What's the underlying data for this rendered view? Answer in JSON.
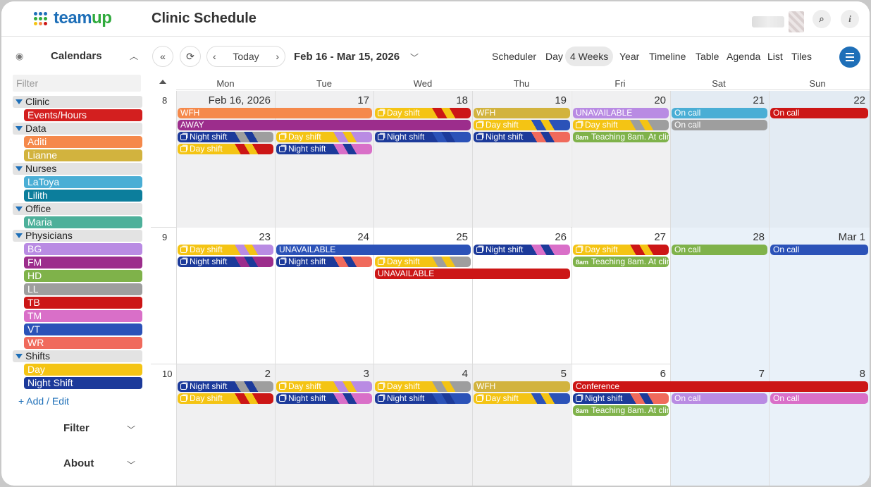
{
  "app": {
    "logo_text_a": "team",
    "logo_text_b": "up",
    "page_title": "Clinic Schedule"
  },
  "topbar": {
    "search_icon": "search-icon",
    "info_icon": "info-icon",
    "search_glyph": "⌕",
    "info_glyph": "i"
  },
  "sidebar": {
    "calendars_title": "Calendars",
    "filter_placeholder": "Filter",
    "groups": [
      {
        "name": "Clinic",
        "items": [
          {
            "label": "Events/Hours",
            "color": "#d31f1f"
          }
        ]
      },
      {
        "name": "Data",
        "items": [
          {
            "label": "Aditi",
            "color": "#f5894b"
          },
          {
            "label": "Lianne",
            "color": "#d2b33e"
          }
        ]
      },
      {
        "name": "Nurses",
        "items": [
          {
            "label": "LaToya",
            "color": "#4aaed5"
          },
          {
            "label": "Lilith",
            "color": "#0c7e9c"
          }
        ]
      },
      {
        "name": "Office",
        "items": [
          {
            "label": "Maria",
            "color": "#4db09a"
          }
        ]
      },
      {
        "name": "Physicians",
        "items": [
          {
            "label": "BG",
            "color": "#b98be3"
          },
          {
            "label": "FM",
            "color": "#9c2d8c"
          },
          {
            "label": "HD",
            "color": "#7fb24a"
          },
          {
            "label": "LL",
            "color": "#9e9e9e"
          },
          {
            "label": "TB",
            "color": "#cc1616"
          },
          {
            "label": "TM",
            "color": "#d96fc8"
          },
          {
            "label": "VT",
            "color": "#2b52b8"
          },
          {
            "label": "WR",
            "color": "#f06a5c"
          }
        ]
      },
      {
        "name": "Shifts",
        "items": [
          {
            "label": "Day",
            "color": "#f4c414"
          },
          {
            "label": "Night Shift",
            "color": "#1c3a9a"
          }
        ]
      }
    ],
    "add_edit": "+ Add / Edit",
    "filter_section": "Filter",
    "about_section": "About"
  },
  "toolbar": {
    "today": "Today",
    "date_range": "Feb 16 - Mar 15, 2026",
    "views": [
      "Scheduler",
      "Day",
      "4 Weeks",
      "Year",
      "Timeline",
      "Table",
      "Agenda",
      "List",
      "Tiles"
    ],
    "active_view": "4 Weeks"
  },
  "calendar": {
    "day_headers": [
      "Mon",
      "Tue",
      "Wed",
      "Thu",
      "Fri",
      "Sat",
      "Sun"
    ],
    "weeks": [
      {
        "num": "8",
        "days": [
          "Feb 16, 2026",
          "17",
          "18",
          "19",
          "20",
          "21",
          "22"
        ],
        "events": [
          {
            "col": 0,
            "span": 2,
            "lane": 0,
            "text": "WFH",
            "color": "#f5894b"
          },
          {
            "col": 2,
            "span": 1,
            "lane": 0,
            "text": "Day shift",
            "color": "#f4c414",
            "stripe": "#cc1616",
            "icon": true
          },
          {
            "col": 3,
            "span": 1,
            "lane": 0,
            "text": "WFH",
            "color": "#d2b33e"
          },
          {
            "col": 4,
            "span": 1,
            "lane": 0,
            "text": "UNAVAILABLE",
            "color": "#b98be3"
          },
          {
            "col": 5,
            "span": 1,
            "lane": 0,
            "text": "On call",
            "color": "#4aaed5"
          },
          {
            "col": 6,
            "span": 1,
            "lane": 0,
            "text": "On call",
            "color": "#cc1616"
          },
          {
            "col": 0,
            "span": 3,
            "lane": 1,
            "text": "AWAY",
            "color": "#9c2d8c"
          },
          {
            "col": 3,
            "span": 1,
            "lane": 1,
            "text": "Day shift",
            "color": "#f4c414",
            "stripe": "#2b52b8",
            "icon": true
          },
          {
            "col": 4,
            "span": 1,
            "lane": 1,
            "text": "Day shift",
            "color": "#f4c414",
            "stripe": "#9e9e9e",
            "icon": true
          },
          {
            "col": 5,
            "span": 1,
            "lane": 1,
            "text": "On call",
            "color": "#9e9e9e"
          },
          {
            "col": 0,
            "span": 1,
            "lane": 2,
            "text": "Night shift",
            "color": "#1c3a9a",
            "stripe": "#9e9e9e",
            "icon": true
          },
          {
            "col": 1,
            "span": 1,
            "lane": 2,
            "text": "Day shift",
            "color": "#f4c414",
            "stripe": "#b98be3",
            "icon": true
          },
          {
            "col": 2,
            "span": 1,
            "lane": 2,
            "text": "Night shift",
            "color": "#1c3a9a",
            "stripe": "#2b52b8",
            "icon": true
          },
          {
            "col": 3,
            "span": 1,
            "lane": 2,
            "text": "Night shift",
            "color": "#1c3a9a",
            "stripe": "#f06a5c",
            "icon": true
          },
          {
            "col": 4,
            "span": 1,
            "lane": 2,
            "text": "Teaching 8am. At clinic",
            "time": "8am",
            "color": "#7fb24a"
          },
          {
            "col": 0,
            "span": 1,
            "lane": 3,
            "text": "Day shift",
            "color": "#f4c414",
            "stripe": "#cc1616",
            "icon": true
          },
          {
            "col": 1,
            "span": 1,
            "lane": 3,
            "text": "Night shift",
            "color": "#1c3a9a",
            "stripe": "#d96fc8",
            "icon": true
          }
        ]
      },
      {
        "num": "9",
        "days": [
          "23",
          "24",
          "25",
          "26",
          "27",
          "28",
          "Mar 1"
        ],
        "events": [
          {
            "col": 0,
            "span": 1,
            "lane": 0,
            "text": "Day shift",
            "color": "#f4c414",
            "stripe": "#b98be3",
            "icon": true
          },
          {
            "col": 1,
            "span": 2,
            "lane": 0,
            "text": "UNAVAILABLE",
            "color": "#2b52b8"
          },
          {
            "col": 3,
            "span": 1,
            "lane": 0,
            "text": "Night shift",
            "color": "#1c3a9a",
            "stripe": "#d96fc8",
            "icon": true
          },
          {
            "col": 4,
            "span": 1,
            "lane": 0,
            "text": "Day shift",
            "color": "#f4c414",
            "stripe": "#cc1616",
            "icon": true
          },
          {
            "col": 5,
            "span": 1,
            "lane": 0,
            "text": "On call",
            "color": "#7fb24a"
          },
          {
            "col": 6,
            "span": 1,
            "lane": 0,
            "text": "On call",
            "color": "#2b52b8"
          },
          {
            "col": 0,
            "span": 1,
            "lane": 1,
            "text": "Night shift",
            "color": "#1c3a9a",
            "stripe": "#9c2d8c",
            "icon": true
          },
          {
            "col": 1,
            "span": 1,
            "lane": 1,
            "text": "Night shift",
            "color": "#1c3a9a",
            "stripe": "#f06a5c",
            "icon": true
          },
          {
            "col": 2,
            "span": 1,
            "lane": 1,
            "text": "Day shift",
            "color": "#f4c414",
            "stripe": "#9e9e9e",
            "icon": true
          },
          {
            "col": 4,
            "span": 1,
            "lane": 1,
            "text": "Teaching 8am. At clinic",
            "time": "8am",
            "color": "#7fb24a"
          },
          {
            "col": 2,
            "span": 2,
            "lane": 2,
            "text": "UNAVAILABLE",
            "color": "#cc1616"
          }
        ]
      },
      {
        "num": "10",
        "days": [
          "2",
          "3",
          "4",
          "5",
          "6",
          "7",
          "8"
        ],
        "events": [
          {
            "col": 0,
            "span": 1,
            "lane": 0,
            "text": "Night shift",
            "color": "#1c3a9a",
            "stripe": "#9e9e9e",
            "icon": true
          },
          {
            "col": 1,
            "span": 1,
            "lane": 0,
            "text": "Day shift",
            "color": "#f4c414",
            "stripe": "#b98be3",
            "icon": true
          },
          {
            "col": 2,
            "span": 1,
            "lane": 0,
            "text": "Day shift",
            "color": "#f4c414",
            "stripe": "#9e9e9e",
            "icon": true
          },
          {
            "col": 3,
            "span": 1,
            "lane": 0,
            "text": "WFH",
            "color": "#d2b33e"
          },
          {
            "col": 4,
            "span": 3,
            "lane": 0,
            "text": "Conference",
            "color": "#cc1616"
          },
          {
            "col": 0,
            "span": 1,
            "lane": 1,
            "text": "Day shift",
            "color": "#f4c414",
            "stripe": "#cc1616",
            "icon": true
          },
          {
            "col": 1,
            "span": 1,
            "lane": 1,
            "text": "Night shift",
            "color": "#1c3a9a",
            "stripe": "#d96fc8",
            "icon": true
          },
          {
            "col": 2,
            "span": 1,
            "lane": 1,
            "text": "Night shift",
            "color": "#1c3a9a",
            "stripe": "#2b52b8",
            "icon": true
          },
          {
            "col": 3,
            "span": 1,
            "lane": 1,
            "text": "Day shift",
            "color": "#f4c414",
            "stripe": "#2b52b8",
            "icon": true
          },
          {
            "col": 4,
            "span": 1,
            "lane": 1,
            "text": "Night shift",
            "color": "#1c3a9a",
            "stripe": "#f06a5c",
            "icon": true
          },
          {
            "col": 5,
            "span": 1,
            "lane": 1,
            "text": "On call",
            "color": "#b98be3"
          },
          {
            "col": 6,
            "span": 1,
            "lane": 1,
            "text": "On call",
            "color": "#d96fc8"
          },
          {
            "col": 4,
            "span": 1,
            "lane": 2,
            "text": "Teaching 8am. At clinic",
            "time": "8am",
            "color": "#7fb24a"
          }
        ]
      }
    ]
  }
}
